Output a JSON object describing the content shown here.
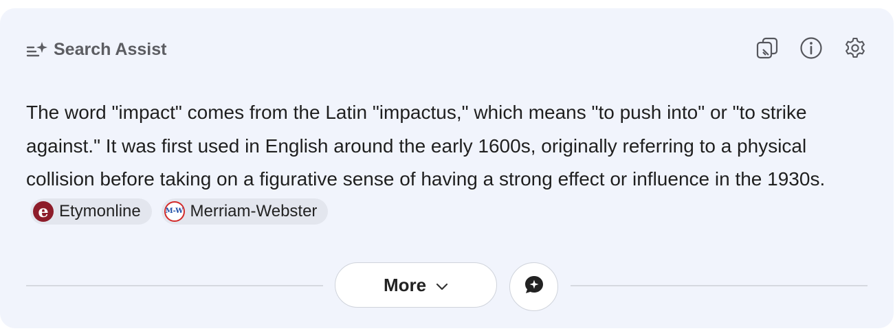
{
  "header": {
    "title": "Search Assist",
    "icon": "list-sparkle-icon"
  },
  "toolbar": {
    "icons": [
      "copy-icon",
      "info-icon",
      "settings-icon"
    ]
  },
  "answer": {
    "text": "The word \"impact\" comes from the Latin \"impactus,\" which means \"to push into\" or \"to strike against.\" It was first used in English around the early 1600s, originally referring to a physical collision before taking on a figurative sense of having a strong effect or influence in the 1930s.",
    "sources": [
      {
        "label": "Etymonline",
        "logo_text": "e",
        "logo_color": "#8d1c2a"
      },
      {
        "label": "Merriam-Webster",
        "logo_text": "M-W",
        "logo_color": "#d22a2a"
      }
    ]
  },
  "actions": {
    "more_label": "More",
    "chat_icon": "chat-sparkle-icon"
  },
  "colors": {
    "card_background": "#f1f4fc",
    "title_gray": "#5c5d62",
    "chip_background": "#e3e6ee"
  }
}
